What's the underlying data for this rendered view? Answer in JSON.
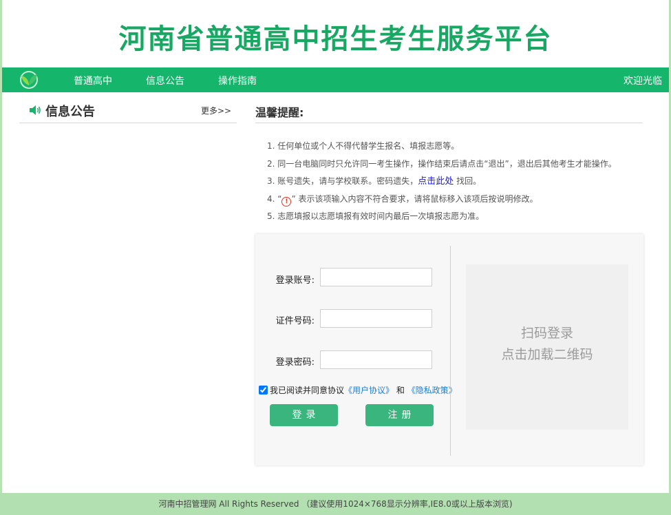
{
  "header": {
    "title": "河南省普通高中招生考生服务平台"
  },
  "nav": {
    "items": [
      "普通高中",
      "信息公告",
      "操作指南"
    ],
    "welcome": "欢迎光临"
  },
  "notice": {
    "title": "信息公告",
    "more": "更多>>"
  },
  "reminder": {
    "title": "温馨提醒:",
    "line1": "1. 任何单位或个人不得代替学生报名、填报志愿等。",
    "line2": "2. 同一台电脑同时只允许同一考生操作，操作结束后请点击“退出”，退出后其他考生才能操作。",
    "line3_prefix": "3. 账号遗失，请与学校联系。密码遗失，",
    "line3_link": "点击此处",
    "line3_suffix": " 找回。",
    "line4_prefix": "4. “",
    "line4_icon": "!",
    "line4_suffix": "” 表示该项输入内容不符合要求，请将鼠标移入该项后按说明修改。",
    "line5": "5. 志愿填报以志愿填报有效时间内最后一次填报志愿为准。"
  },
  "login": {
    "account_label": "登录账号:",
    "account_value": "",
    "id_label": "证件号码:",
    "id_value": "",
    "password_label": "登录密码:",
    "password_value": "",
    "agree_text": "我已阅读并同意协议",
    "user_agreement": "《用户协议》",
    "and_text": " 和 ",
    "privacy_policy": "《隐私政策》",
    "agree_checked": true,
    "login_button": "登录",
    "register_button": "注册"
  },
  "qr": {
    "line1": "扫码登录",
    "line2": "点击加载二维码"
  },
  "footer": {
    "text": "河南中招管理网 All Rights Reserved （建议使用1024×768显示分辨率,IE8.0或以上版本浏览)"
  },
  "colors": {
    "brand_green": "#15b56b",
    "title_green": "#18a863",
    "button_green": "#3ab57e",
    "footer_bg": "#b3e0b1"
  }
}
